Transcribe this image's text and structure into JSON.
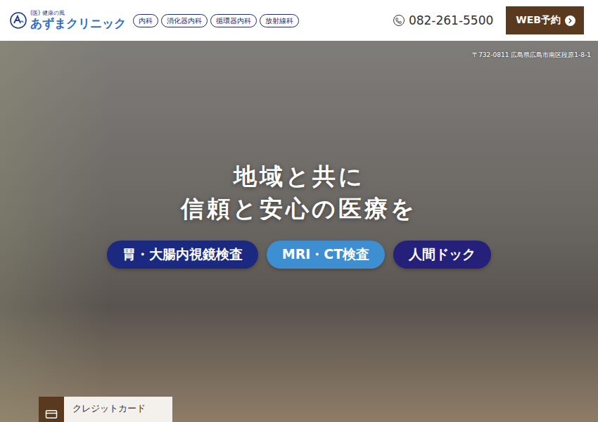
{
  "header": {
    "logo": {
      "sub": "(医) 健康の風",
      "name": "あずまクリニック"
    },
    "departments": [
      "内科",
      "消化器内科",
      "循環器内科",
      "放射線科"
    ],
    "phone": "082-261-5500",
    "reserve_button": "WEB予約"
  },
  "hero": {
    "address": "〒732-0811 広島県広島市南区段原1-8-1",
    "headline": [
      "地域と共に",
      "信頼と安心の医療を"
    ],
    "services": [
      {
        "label": "胃・大腸内視鏡検査",
        "color": "#1b2a80"
      },
      {
        "label": "MRI・CT検査",
        "color": "#3d8fd1"
      },
      {
        "label": "人間ドック",
        "color": "#25207a"
      }
    ]
  },
  "floating_card": {
    "label": "クレジットカード"
  }
}
